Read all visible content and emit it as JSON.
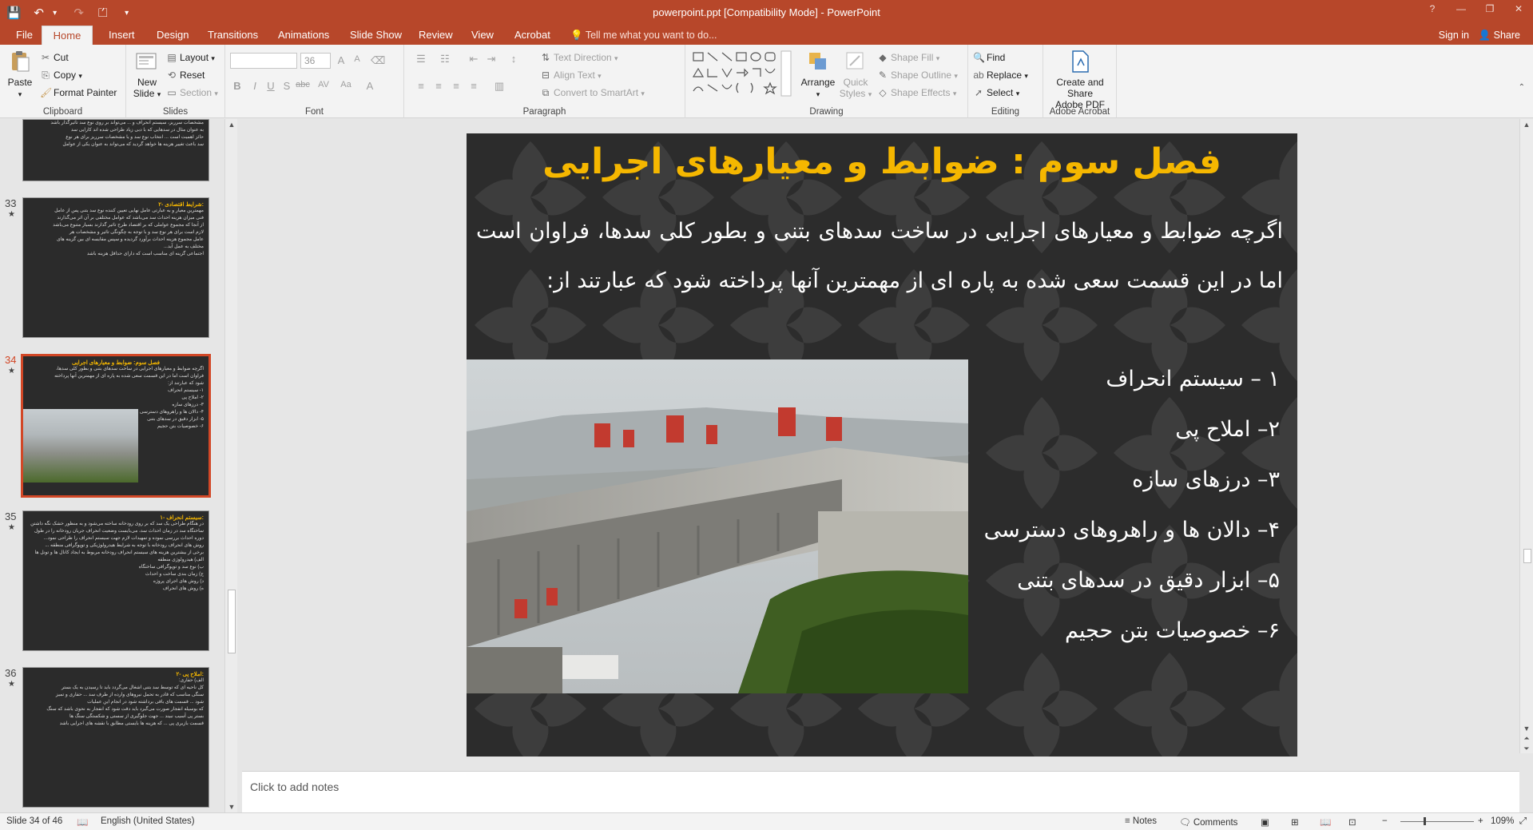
{
  "window": {
    "title": "powerpoint.ppt [Compatibility Mode] - PowerPoint",
    "controls": [
      "?",
      "—",
      "❐",
      "✕"
    ]
  },
  "qat": {
    "save": "💾",
    "undo": "↶",
    "undo_drop": "▾",
    "redo": "↷",
    "start": "⏍",
    "customize": "▾"
  },
  "tabs": [
    {
      "label": "File"
    },
    {
      "label": "Home"
    },
    {
      "label": "Insert"
    },
    {
      "label": "Design"
    },
    {
      "label": "Transitions"
    },
    {
      "label": "Animations"
    },
    {
      "label": "Slide Show"
    },
    {
      "label": "Review"
    },
    {
      "label": "View"
    },
    {
      "label": "Acrobat"
    }
  ],
  "tell_me": "Tell me what you want to do...",
  "sign_in": "Sign in",
  "share": "Share",
  "ribbon": {
    "clipboard": {
      "label": "Clipboard",
      "paste": "Paste",
      "cut": "Cut",
      "copy": "Copy",
      "format_painter": "Format Painter"
    },
    "slides": {
      "label": "Slides",
      "new_slide": "New",
      "new_slide2": "Slide",
      "layout": "Layout",
      "reset": "Reset",
      "section": "Section"
    },
    "font": {
      "label": "Font",
      "name": "",
      "size": "36",
      "b": "B",
      "i": "I",
      "u": "U",
      "s": "S",
      "ab": "abc",
      "av": "AV",
      "aa": "Aa",
      "color": "A"
    },
    "paragraph": {
      "label": "Paragraph",
      "text_direction": "Text Direction",
      "align_text": "Align Text",
      "smartart": "Convert to SmartArt"
    },
    "drawing": {
      "label": "Drawing",
      "arrange": "Arrange",
      "quick_styles": "Quick",
      "quick_styles2": "Styles",
      "shape_fill": "Shape Fill",
      "shape_outline": "Shape Outline",
      "shape_effects": "Shape Effects"
    },
    "editing": {
      "label": "Editing",
      "find": "Find",
      "replace": "Replace",
      "select": "Select"
    },
    "acrobat": {
      "label": "Adobe Acrobat",
      "create": "Create and Share",
      "create2": "Adobe PDF"
    }
  },
  "thumbnails": [
    {
      "num": "",
      "title": "",
      "lines": [
        "مشخصات سرریز، سیستم انحراف و ... می‌تواند بر روی نوع سد تاثیرگذار باشد",
        "به عنوان مثال در سدهایی که با دبی زیاد طراحی شده اند کارایی سد",
        "حائز اهمیت است ... انتخاب نوع سد و یا مشخصات سرریز برای هر نوع",
        "سد باعث تغییر هزینه ها خواهد گردید که می‌تواند به عنوان یکی از عوامل"
      ]
    },
    {
      "num": "33",
      "title": "۲- شرایط اقتصادی:",
      "lines": [
        "مهمترین معیار و به عبارتی عامل نهایی تعیین کننده نوع سد بتنی پس از عامل",
        "فنی میزان هزینه احداث سد می‌باشد که عوامل مختلفی بر آن اثر می‌گذارند",
        "از آنجا که مجموع عواملی که بر اقتصاد طرح تاثیر گذارند بسیار متنوع می‌باشد",
        "لازم است برای هر نوع سد و با توجه به چگونگی تاثیر و مشخصات هر",
        "عامل مجموع هزینه احداث برآورد گردیده و سپس مقایسه ای بین گزینه های",
        "مختلف به عمل آید...",
        "اجتماعی گزینه ای مناسب است که دارای حداقل هزینه باشد"
      ]
    },
    {
      "num": "34",
      "title": "فصل سوم: ضوابط و معیارهای اجرایی",
      "lines": [
        "اگرچه ضوابط و معیارهای اجرایی در ساخت سدهای بتنی و بطور کلی سدها،",
        "فراوان است اما در این قسمت سعی شده به پاره ای از مهمترین آنها پرداخته",
        "شود که عبارتند از:",
        "۱- سیستم انحراف",
        "۲- املاح پی",
        "۳- درزهای سازه",
        "۴- دالان ها و راهروهای دسترسی",
        "۵- ابزار دقیق در سدهای بتنی",
        "۶- خصوصیات بتن حجیم"
      ]
    },
    {
      "num": "35",
      "title": "۱- سیستم انحراف:",
      "lines": [
        "در هنگام طراحی یک سد که بر روی رودخانه ساخته می‌شود و به منظور خشک نگه داشتن",
        "ساختگاه سد در زمان احداث سد، می‌بایست وضعیت انحراف جریان رودخانه را در طول",
        "دوره احداث بررسی نموده و تمهیدات لازم جهت سیستم انحراف را طراحی نمود...",
        "روش های انحراف رودخانه با توجه به شرایط هیدرولوژیکی و توپوگرافی منطقه ...",
        "برخی از بیشترین هزینه های سیستم انحراف رودخانه مربوط به ایجاد کانال ها و تونل ها",
        "الف) هیدرولوژی منطقه",
        "ب) نوع سد و توپوگرافی ساختگاه",
        "ج) زمان بندی ساخت و احداث",
        "د) روش های اجرای پروژه",
        "ه) روش های انحراف"
      ]
    },
    {
      "num": "36",
      "title": "۲- املاح پی:",
      "lines": [
        "الف) حفاری:",
        "کل ناحیه ای که توسط سد بتنی اشغال می‌گردد باید تا رسیدن به یک بستر",
        "سنگی مناسب که قادر به تحمل نیروهای وارده از طرف سد ... حفاری و تمیز",
        "شود ... قسمت های باقی برداشته شود در انجام این عملیات",
        "که بوسیله انفجار صورت می‌گیرد باید دقت شود که انفجار به نحوی باشد که سنگ",
        "بستر پی آسیب نبیند ... جهت جلوگیری از سستی و شکستگی سنگ ها",
        "قسمت بازیری پی ... که هزینه ها بایستی مطابق با نقشه های اجرایی باشد"
      ]
    }
  ],
  "slide": {
    "title": "فصل سوم : ضوابط و معیارهای اجرایی",
    "body": "اگرچه ضوابط و معیارهای اجرایی در ساخت سدهای بتنی و بطور کلی سدها، فراوان است اما در این قسمت سعی شده به پاره ای از مهمترین آنها پرداخته شود که عبارتند از:",
    "items": [
      "۱ – سیستم انحراف",
      "۲– املاح پی",
      "۳– درزهای سازه",
      "۴– دالان ها و راهروهای دسترسی",
      "۵– ابزار دقیق در سدهای بتنی",
      "۶– خصوصیات بتن حجیم"
    ]
  },
  "notes_placeholder": "Click to add notes",
  "status": {
    "slide_info": "Slide 34 of 46",
    "language": "English (United States)",
    "notes": "Notes",
    "comments": "Comments",
    "zoom": "109%"
  },
  "colors": {
    "accent": "#b7472a",
    "title_yellow": "#f5b700",
    "slide_bg": "#2c2c2c"
  }
}
